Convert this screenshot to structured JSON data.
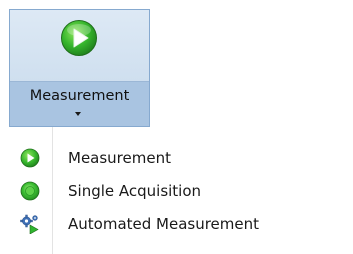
{
  "ribbon": {
    "measurement_button": {
      "label": "Measurement",
      "icon": "play-green-icon"
    }
  },
  "menu": {
    "items": [
      {
        "label": "Measurement",
        "icon": "play-green-icon"
      },
      {
        "label": "Single Acquisition",
        "icon": "green-dot-icon"
      },
      {
        "label": "Automated Measurement",
        "icon": "gears-play-icon"
      }
    ]
  },
  "colors": {
    "accent_green": "#2fb52f",
    "ribbon_selected_bg": "#a9c4e1",
    "ribbon_border": "#86a9cf"
  }
}
